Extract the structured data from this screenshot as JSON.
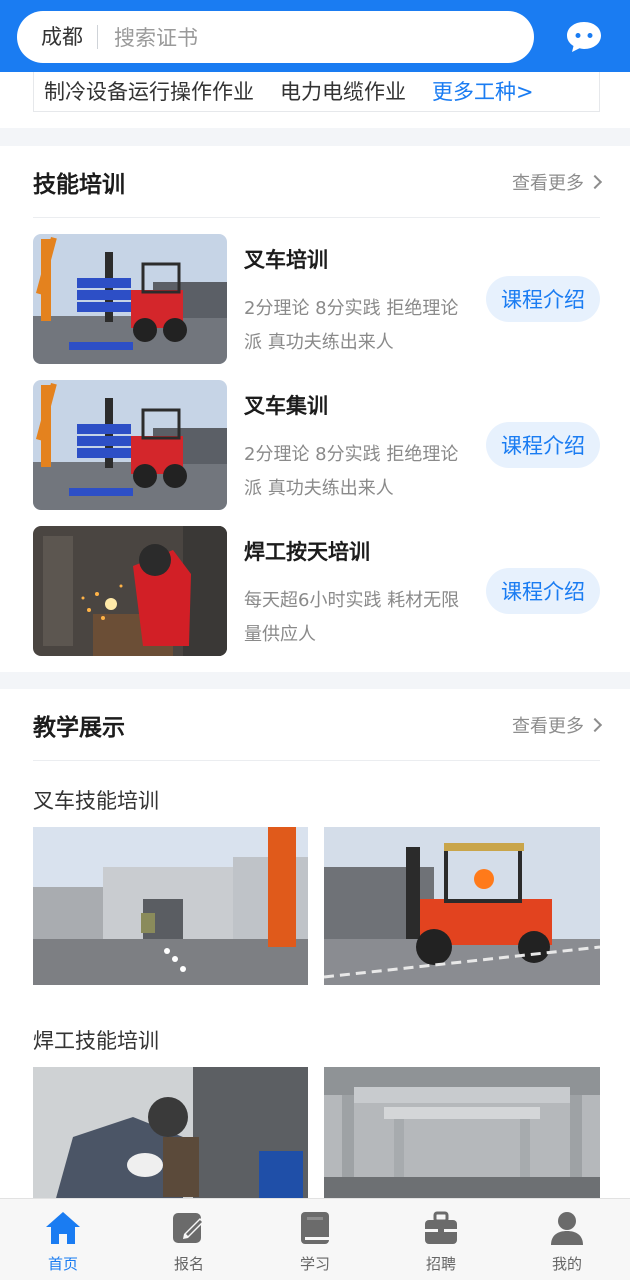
{
  "header": {
    "city": "成都",
    "search_placeholder": "搜索证书",
    "message_icon": "chat-bubble-icon"
  },
  "categories": {
    "items": [
      "制冷设备运行操作作业",
      "电力电缆作业"
    ],
    "more_label": "更多工种>"
  },
  "skills": {
    "title": "技能培训",
    "more_label": "查看更多",
    "courses": [
      {
        "title": "叉车培训",
        "desc": "2分理论 8分实践 拒绝理论派 真功夫练出来人",
        "button": "课程介绍"
      },
      {
        "title": "叉车集训",
        "desc": "2分理论 8分实践 拒绝理论派 真功夫练出来人",
        "button": "课程介绍"
      },
      {
        "title": "焊工按天培训",
        "desc": "每天超6小时实践 耗材无限量供应人",
        "button": "课程介绍"
      }
    ]
  },
  "teaching": {
    "title": "教学展示",
    "more_label": "查看更多",
    "groups": [
      {
        "label": "叉车技能培训"
      },
      {
        "label": "焊工技能培训"
      }
    ]
  },
  "tabbar": {
    "active_color": "#1a7cf2",
    "items": [
      {
        "label": "首页",
        "icon": "home-icon"
      },
      {
        "label": "报名",
        "icon": "edit-form-icon"
      },
      {
        "label": "学习",
        "icon": "book-icon"
      },
      {
        "label": "招聘",
        "icon": "briefcase-icon"
      },
      {
        "label": "我的",
        "icon": "user-icon"
      }
    ]
  }
}
